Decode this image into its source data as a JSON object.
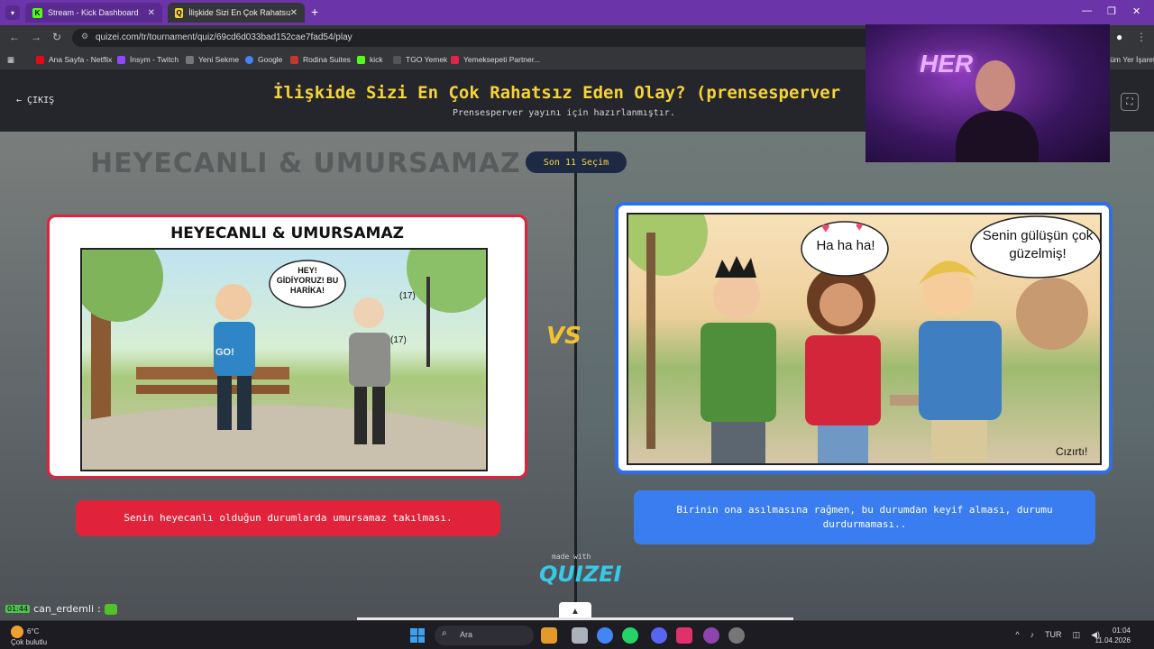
{
  "browser": {
    "tabs": [
      {
        "label": "Stream - Kick Dashboard",
        "active": false
      },
      {
        "label": "İlişkide Sizi En Çok Rahatsız Ede",
        "active": true
      }
    ],
    "url": "quizei.com/tr/tournament/quiz/69cd6d033bad152cae7fad54/play",
    "bookmarks": [
      "Ana Sayfa - Netflix",
      "İnsym - Twitch",
      "Yeni Sekme",
      "Google",
      "Rodina Suites",
      "kick",
      "TGO Yemek",
      "Yemeksepeti Partner..."
    ],
    "bookmarks_right": "Tüm Yer İşaretleri"
  },
  "page": {
    "exit_label": "ÇIKIŞ",
    "title": "İlişkide Sizi En Çok Rahatsız Eden Olay? (prensesperver",
    "subtitle": "Prensesperver yayını için hazırlanmıştır.",
    "round_badge": "Son 11 Seçim",
    "vs_label": "VS",
    "made_with": "made with",
    "brand": "QUIZEI"
  },
  "left_option": {
    "panel_title": "HEYECANLI & UMURSAMAZ",
    "speech": "HEY! GİDİYORUZ! BU HARİKA!",
    "shirt_text": "GO!",
    "age_labels": [
      "(17)",
      "(17)"
    ],
    "caption": "Senin heyecanlı olduğun durumlarda umursamaz takılması."
  },
  "right_option": {
    "speech_laugh": "Ha ha ha!",
    "speech_compliment": "Senin gülüşün çok güzelmiş!",
    "sfx": "Cızırtı!",
    "caption": "Birinin ona asılmasına rağmen, bu durumdan keyif alması, durumu durdurmaması.."
  },
  "chat": {
    "badge": "01:44",
    "username": "can_erdemli",
    "separator": ":"
  },
  "taskbar": {
    "weather_temp": "6°C",
    "weather_desc": "Çok bulutlu",
    "search_placeholder": "Ara",
    "language": "TUR",
    "time": "01:04",
    "date": "11.04.2026"
  },
  "colors": {
    "accent_yellow": "#f5d33a",
    "left_red": "#e0233a",
    "right_blue": "#3a7df0",
    "tabbar_purple": "#6b34a8"
  }
}
